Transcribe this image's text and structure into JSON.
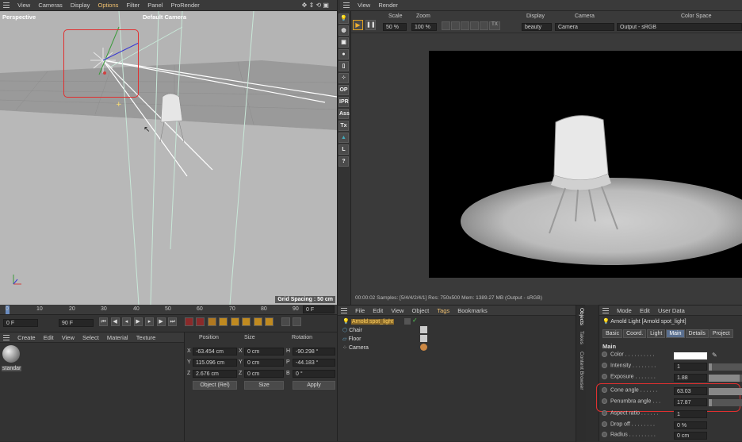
{
  "viewport": {
    "menu": [
      "View",
      "Cameras",
      "Display",
      "Options",
      "Filter",
      "Panel",
      "ProRender"
    ],
    "label": "Perspective",
    "camera": "Default Camera",
    "grid_spacing": "Grid Spacing : 50 cm"
  },
  "side_toolbar": [
    "OP",
    "IPR",
    "Ass",
    "Tx",
    "L",
    "?"
  ],
  "render_view": {
    "menu": [
      "View",
      "Render"
    ],
    "scale_label": "Scale",
    "scale": "50 %",
    "zoom_label": "Zoom",
    "zoom": "100 %",
    "tx_label": "TX",
    "display_label": "Display",
    "display": "beauty",
    "camera_label": "Camera",
    "camera": "Camera",
    "colorspace_label": "Color Space",
    "colorspace": "Output - sRGB",
    "status": {
      "time": "00:00:02",
      "samples": "Samples: [5/4/4/2/4/1]",
      "res": "Res: 750x500",
      "mem": "Mem: 1389.27 MB",
      "output": "(Output - sRGB)"
    }
  },
  "timeline": {
    "ticks": [
      "0",
      "10",
      "20",
      "30",
      "40",
      "50",
      "60",
      "70",
      "80",
      "90"
    ],
    "end_frame": "0 F",
    "current": "0 F",
    "max": "90 F"
  },
  "material_manager": {
    "menu": [
      "Create",
      "Edit",
      "View",
      "Select",
      "Material",
      "Texture"
    ],
    "material": "standar"
  },
  "coordinates": {
    "headers": [
      "Position",
      "Size",
      "Rotation"
    ],
    "rows": [
      {
        "axis": "X",
        "pos": "-63.454 cm",
        "size_axis": "X",
        "size": "0 cm",
        "rot_axis": "H",
        "rot": "-90.298 °"
      },
      {
        "axis": "Y",
        "pos": "115.096 cm",
        "size_axis": "Y",
        "size": "0 cm",
        "rot_axis": "P",
        "rot": "-44.183 °"
      },
      {
        "axis": "Z",
        "pos": "2.676 cm",
        "size_axis": "Z",
        "size": "0 cm",
        "rot_axis": "B",
        "rot": "0 °"
      }
    ],
    "mode": "Object (Rel)",
    "size_mode": "Size",
    "apply": "Apply"
  },
  "objects": {
    "menu": [
      "File",
      "Edit",
      "View",
      "Object",
      "Tags",
      "Bookmarks"
    ],
    "items": [
      "Arnold spot_light",
      "Chair",
      "Floor",
      "Camera"
    ],
    "side_tabs": [
      "Objects",
      "Takes",
      "Content Browser"
    ]
  },
  "attributes": {
    "menu": [
      "Mode",
      "Edit",
      "User Data"
    ],
    "title": "Arnold Light [Arnold spot_light]",
    "tabs": [
      "Basic",
      "Coord.",
      "Light",
      "Main",
      "Details",
      "Project"
    ],
    "section": "Main",
    "rows": [
      {
        "label": "Color",
        "value": ""
      },
      {
        "label": "Intensity",
        "value": "1"
      },
      {
        "label": "Exposure",
        "value": "1.88"
      },
      {
        "label": "Cone angle",
        "value": "63.03"
      },
      {
        "label": "Penumbra angle",
        "value": "17.87"
      },
      {
        "label": "Aspect ratio",
        "value": "1"
      },
      {
        "label": "Drop off",
        "value": "0 %"
      },
      {
        "label": "Radius",
        "value": "0 cm"
      }
    ],
    "slider_levels": [
      null,
      0.1,
      0.9,
      1.0,
      0.1
    ]
  },
  "colors": {
    "highlight": "#e03030",
    "accent": "#f0c070",
    "active_tab": "#5a6f8f"
  }
}
